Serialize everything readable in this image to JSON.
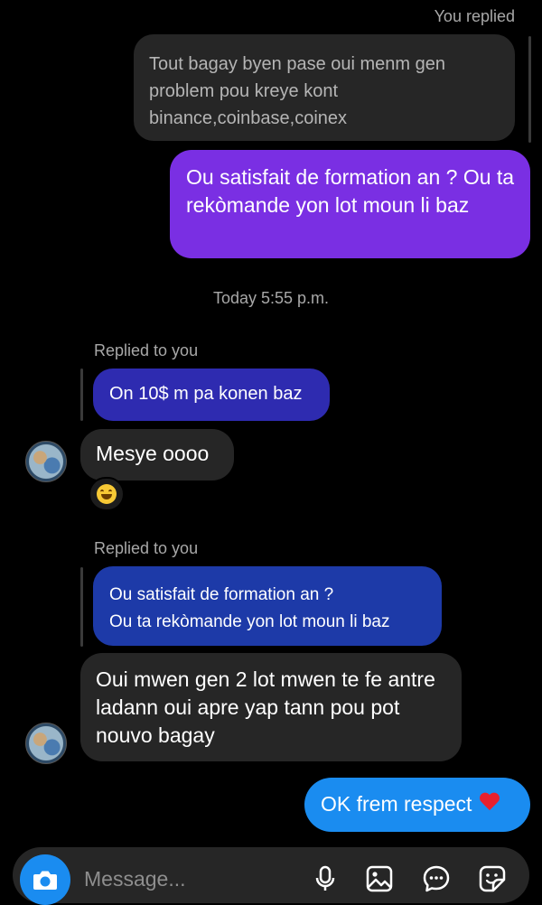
{
  "header_label": "You replied",
  "outgoing_quoted": "Tout bagay byen pase oui menm gen problem pou kreye kont binance,coinbase,coinex",
  "outgoing_question": "Ou satisfait de formation an ? Ou ta rekòmande yon lot moun li baz",
  "timestamp": "Today 5:55 p.m.",
  "thread": [
    {
      "replied_label": "Replied to you",
      "quoted": "On 10$ m pa konen baz",
      "message": "Mesye oooo",
      "reaction_icon": "grinning-sweat-emoji-icon"
    },
    {
      "replied_label": "Replied to you",
      "quoted_lines": [
        "Ou satisfait de formation an ?",
        "Ou ta rekòmande yon lot moun li baz"
      ],
      "message": "Oui mwen gen 2 lot mwen te fe antre ladann oui apre yap tann pou pot nouvo bagay"
    }
  ],
  "final_message": "OK frem respect",
  "final_emoji": "red-heart-icon",
  "composer": {
    "placeholder": "Message...",
    "icons": [
      "camera-icon",
      "microphone-icon",
      "gallery-icon",
      "chat-bubble-icon",
      "sticker-icon"
    ]
  },
  "colors": {
    "background": "#000000",
    "outgoing_purple": "#7a2fe3",
    "outgoing_blue": "#1a8cf0",
    "incoming_gray": "#262626",
    "quoted_blue": "#1d3aa8"
  }
}
